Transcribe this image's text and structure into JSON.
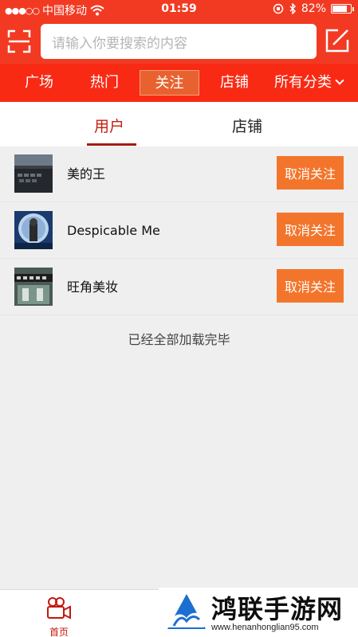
{
  "status_bar": {
    "carrier": "中国移动",
    "time": "01:59",
    "battery": "82%",
    "battery_level": 0.82
  },
  "search": {
    "placeholder": "请输入你要搜索的内容"
  },
  "nav": {
    "items": [
      {
        "label": "广场"
      },
      {
        "label": "热门"
      },
      {
        "label": "关注"
      },
      {
        "label": "店铺"
      },
      {
        "label": "所有分类"
      }
    ],
    "active_index": 2
  },
  "subtabs": [
    {
      "label": "用户"
    },
    {
      "label": "店铺"
    }
  ],
  "follow_list": [
    {
      "name": "美的王",
      "action": "取消关注"
    },
    {
      "name": "Despicable Me",
      "action": "取消关注"
    },
    {
      "name": "旺角美妆",
      "action": "取消关注"
    }
  ],
  "load_complete": "已经全部加载完毕",
  "tabbar": {
    "home_label": "首页"
  },
  "watermark": {
    "title": "鸿联手游网",
    "url": "www.henanhonglian95.com"
  },
  "colors": {
    "header_red": "#f23a23",
    "nav_red": "#f92a14",
    "button_orange": "#f3752b",
    "active_tab_red": "#c31f10"
  }
}
